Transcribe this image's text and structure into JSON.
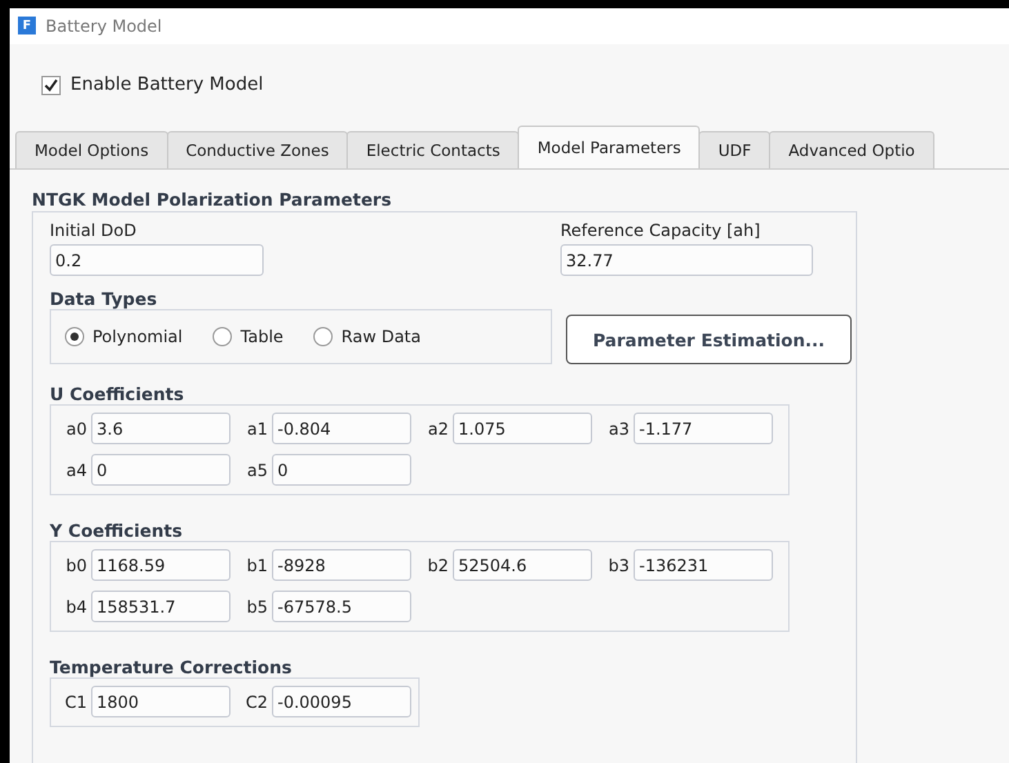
{
  "window": {
    "title": "Battery Model",
    "app_icon": "F"
  },
  "enable_checkbox": {
    "label": "Enable Battery Model",
    "checked": true
  },
  "tabs": [
    {
      "label": "Model Options",
      "selected": false
    },
    {
      "label": "Conductive Zones",
      "selected": false
    },
    {
      "label": "Electric Contacts",
      "selected": false
    },
    {
      "label": "Model Parameters",
      "selected": true
    },
    {
      "label": "UDF",
      "selected": false
    },
    {
      "label": "Advanced Optio",
      "selected": false
    }
  ],
  "section": {
    "title": "NTGK Model Polarization Parameters",
    "initial_dod": {
      "label": "Initial DoD",
      "value": "0.2"
    },
    "reference_capacity": {
      "label": "Reference Capacity [ah]",
      "value": "32.77"
    },
    "data_types": {
      "title": "Data Types",
      "options": [
        {
          "label": "Polynomial",
          "selected": true
        },
        {
          "label": "Table",
          "selected": false
        },
        {
          "label": "Raw Data",
          "selected": false
        }
      ]
    },
    "parameter_button": "Parameter Estimation...",
    "groups": [
      {
        "title": "U Coefficients",
        "fields": [
          {
            "label": "a0",
            "value": "3.6"
          },
          {
            "label": "a1",
            "value": "-0.804"
          },
          {
            "label": "a2",
            "value": "1.075"
          },
          {
            "label": "a3",
            "value": "-1.177"
          },
          {
            "label": "a4",
            "value": "0"
          },
          {
            "label": "a5",
            "value": "0"
          }
        ]
      },
      {
        "title": "Y Coefficients",
        "fields": [
          {
            "label": "b0",
            "value": "1168.59"
          },
          {
            "label": "b1",
            "value": "-8928"
          },
          {
            "label": "b2",
            "value": "52504.6"
          },
          {
            "label": "b3",
            "value": "-136231"
          },
          {
            "label": "b4",
            "value": "158531.7"
          },
          {
            "label": "b5",
            "value": "-67578.5"
          }
        ]
      },
      {
        "title": "Temperature Corrections",
        "fields": [
          {
            "label": "C1",
            "value": "1800"
          },
          {
            "label": "C2",
            "value": "-0.00095"
          }
        ]
      }
    ]
  }
}
